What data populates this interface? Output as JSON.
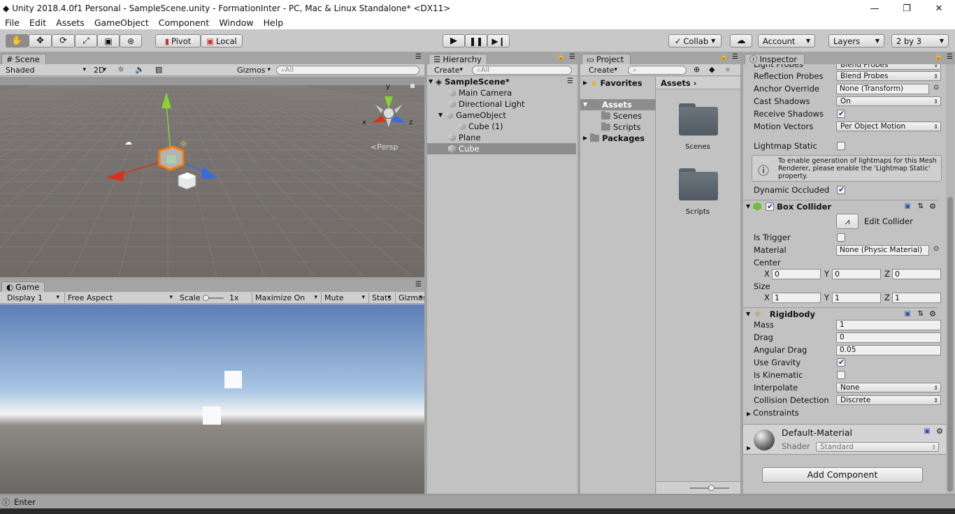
{
  "window": {
    "title": "Unity 2018.4.0f1 Personal - SampleScene.unity - FormationInter - PC, Mac & Linux Standalone* <DX11>"
  },
  "menu": [
    "File",
    "Edit",
    "Assets",
    "GameObject",
    "Component",
    "Window",
    "Help"
  ],
  "toolbar": {
    "pivot": "Pivot",
    "local": "Local",
    "collab": "Collab",
    "account": "Account",
    "layers": "Layers",
    "layout": "2 by 3"
  },
  "scene": {
    "tab": "Scene",
    "shading": "Shaded",
    "mode2d": "2D",
    "gizmos": "Gizmos",
    "search_placeholder": "All",
    "persp": "Persp",
    "axis_y": "y",
    "axis_x": "x",
    "axis_z": "z"
  },
  "game": {
    "tab": "Game",
    "display": "Display 1",
    "aspect": "Free Aspect",
    "scale_label": "Scale",
    "scale_value": "1x",
    "maximize": "Maximize On Play",
    "mute": "Mute Audio",
    "stats": "Stats",
    "gizmos": "Gizmos"
  },
  "hierarchy": {
    "tab": "Hierarchy",
    "create": "Create",
    "search_placeholder": "All",
    "scene_name": "SampleScene*",
    "items": [
      {
        "label": "Main Camera"
      },
      {
        "label": "Directional Light"
      },
      {
        "label": "GameObject"
      },
      {
        "label": "Cube (1)"
      },
      {
        "label": "Plane"
      },
      {
        "label": "Cube"
      }
    ]
  },
  "project": {
    "tab": "Project",
    "create": "Create",
    "favorites": "Favorites",
    "assets": "Assets",
    "scenes": "Scenes",
    "scripts": "Scripts",
    "packages": "Packages",
    "breadcrumb": "Assets",
    "files": [
      {
        "label": "Scenes"
      },
      {
        "label": "Scripts"
      }
    ]
  },
  "inspector": {
    "tab": "Inspector",
    "top_partial": "Light Probes",
    "top_partial_value": "Blend Probes",
    "renderer": [
      {
        "label": "Reflection Probes",
        "value": "Blend Probes"
      },
      {
        "label": "Anchor Override",
        "value": "None (Transform)"
      },
      {
        "label": "Cast Shadows",
        "value": "On"
      },
      {
        "label": "Receive Shadows"
      },
      {
        "label": "Motion Vectors",
        "value": "Per Object Motion"
      }
    ],
    "lightmap_static": "Lightmap Static",
    "info": "To enable generation of lightmaps for this Mesh Renderer, please enable the 'Lightmap Static' property.",
    "dynamic_occluded": "Dynamic Occluded",
    "box_collider": {
      "title": "Box Collider",
      "edit": "Edit Collider",
      "is_trigger": "Is Trigger",
      "material_label": "Material",
      "material_value": "None (Physic Material)",
      "center_label": "Center",
      "size_label": "Size",
      "cx": "0",
      "cy": "0",
      "cz": "0",
      "sx": "1",
      "sy": "1",
      "sz": "1",
      "x": "X",
      "y": "Y",
      "z": "Z"
    },
    "rigidbody": {
      "title": "Rigidbody",
      "mass_label": "Mass",
      "mass": "1",
      "drag_label": "Drag",
      "drag": "0",
      "ang_label": "Angular Drag",
      "ang": "0.05",
      "gravity_label": "Use Gravity",
      "kinematic_label": "Is Kinematic",
      "interp_label": "Interpolate",
      "interp": "None",
      "collision_label": "Collision Detection",
      "collision": "Discrete",
      "constraints_label": "Constraints"
    },
    "material": {
      "name": "Default-Material",
      "shader_label": "Shader",
      "shader": "Standard"
    },
    "add_component": "Add Component"
  },
  "status": {
    "text": "Enter"
  },
  "colors": {
    "selection": "#3d6ab3",
    "x_axis": "#d8321c",
    "y_axis": "#8ad132",
    "z_axis": "#3a6ae0"
  }
}
